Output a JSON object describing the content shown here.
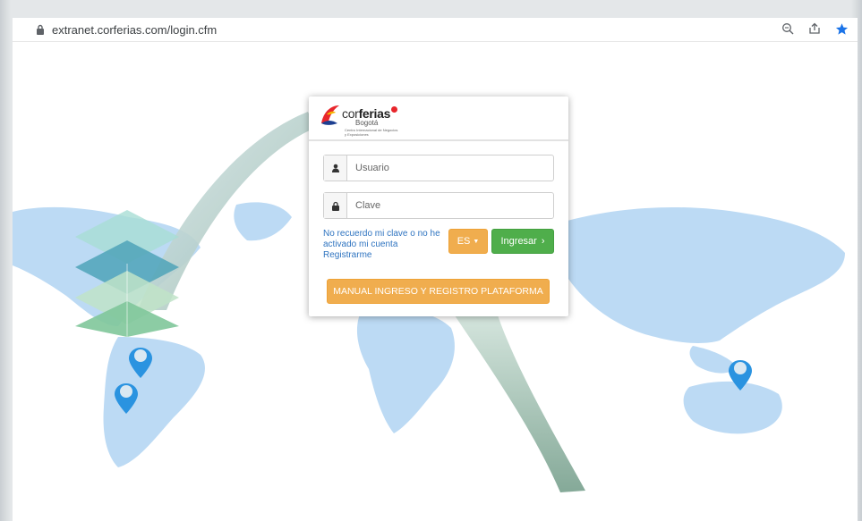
{
  "browser": {
    "url": "extranet.corferias.com/login.cfm"
  },
  "logo": {
    "brand_light": "cor",
    "brand_bold": "ferias",
    "city": "Bogotá",
    "tagline": "Centro Internacional de Negocios y Exposiciones"
  },
  "form": {
    "username_placeholder": "Usuario",
    "password_placeholder": "Clave",
    "forgot_link": "No recuerdo mi clave o no he activado mi cuenta",
    "register_link": "Registrarme",
    "language_button": "ES",
    "login_button": "Ingresar",
    "manual_button": "MANUAL INGRESO Y REGISTRO PLATAFORMA"
  },
  "colors": {
    "orange": "#f0ad4e",
    "green": "#4fae4b",
    "link": "#2f74c0",
    "map": "#bcdaf4",
    "pin": "#2a93e0"
  }
}
